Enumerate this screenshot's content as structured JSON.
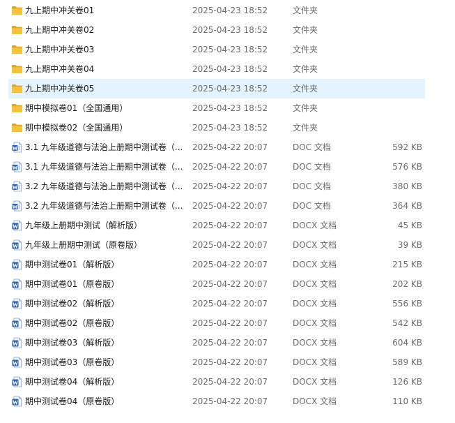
{
  "files": [
    {
      "name": "九上期中冲关卷01",
      "date": "2025-04-23 18:52",
      "type": "文件夹",
      "size": "",
      "icon": "folder-icon"
    },
    {
      "name": "九上期中冲关卷02",
      "date": "2025-04-23 18:52",
      "type": "文件夹",
      "size": "",
      "icon": "folder-icon"
    },
    {
      "name": "九上期中冲关卷03",
      "date": "2025-04-23 18:52",
      "type": "文件夹",
      "size": "",
      "icon": "folder-icon"
    },
    {
      "name": "九上期中冲关卷04",
      "date": "2025-04-23 18:52",
      "type": "文件夹",
      "size": "",
      "icon": "folder-icon"
    },
    {
      "name": "九上期中冲关卷05",
      "date": "2025-04-23 18:52",
      "type": "文件夹",
      "size": "",
      "icon": "folder-icon",
      "selected": true
    },
    {
      "name": "期中模拟卷01（全国通用）",
      "date": "2025-04-23 18:52",
      "type": "文件夹",
      "size": "",
      "icon": "folder-icon"
    },
    {
      "name": "期中模拟卷02（全国通用）",
      "date": "2025-04-23 18:52",
      "type": "文件夹",
      "size": "",
      "icon": "folder-icon"
    },
    {
      "name": "3.1 九年级道德与法治上册期中测试卷（...",
      "date": "2025-04-22 20:07",
      "type": "DOC 文档",
      "size": "592 KB",
      "icon": "word-doc-icon"
    },
    {
      "name": "3.1 九年级道德与法治上册期中测试卷（...",
      "date": "2025-04-22 20:07",
      "type": "DOC 文档",
      "size": "576 KB",
      "icon": "word-doc-icon"
    },
    {
      "name": "3.2 九年级道德与法治上册期中测试卷（...",
      "date": "2025-04-22 20:07",
      "type": "DOC 文档",
      "size": "380 KB",
      "icon": "word-doc-icon"
    },
    {
      "name": "3.2 九年级道德与法治上册期中测试卷（...",
      "date": "2025-04-22 20:07",
      "type": "DOC 文档",
      "size": "364 KB",
      "icon": "word-doc-icon"
    },
    {
      "name": "九年级上册期中测试（解析版）",
      "date": "2025-04-22 20:07",
      "type": "DOCX 文档",
      "size": "45 KB",
      "icon": "word-docx-icon"
    },
    {
      "name": "九年级上册期中测试（原卷版）",
      "date": "2025-04-22 20:07",
      "type": "DOCX 文档",
      "size": "39 KB",
      "icon": "word-docx-icon"
    },
    {
      "name": "期中测试卷01（解析版）",
      "date": "2025-04-22 20:07",
      "type": "DOCX 文档",
      "size": "215 KB",
      "icon": "word-docx-icon"
    },
    {
      "name": "期中测试卷01（原卷版）",
      "date": "2025-04-22 20:07",
      "type": "DOCX 文档",
      "size": "202 KB",
      "icon": "word-docx-icon"
    },
    {
      "name": "期中测试卷02（解析版）",
      "date": "2025-04-22 20:07",
      "type": "DOCX 文档",
      "size": "556 KB",
      "icon": "word-docx-icon"
    },
    {
      "name": "期中测试卷02（原卷版）",
      "date": "2025-04-22 20:07",
      "type": "DOCX 文档",
      "size": "542 KB",
      "icon": "word-docx-icon"
    },
    {
      "name": "期中测试卷03（解析版）",
      "date": "2025-04-22 20:07",
      "type": "DOCX 文档",
      "size": "604 KB",
      "icon": "word-docx-icon"
    },
    {
      "name": "期中测试卷03（原卷版）",
      "date": "2025-04-22 20:07",
      "type": "DOCX 文档",
      "size": "589 KB",
      "icon": "word-docx-icon"
    },
    {
      "name": "期中测试卷04（解析版）",
      "date": "2025-04-22 20:07",
      "type": "DOCX 文档",
      "size": "126 KB",
      "icon": "word-docx-icon"
    },
    {
      "name": "期中测试卷04（原卷版）",
      "date": "2025-04-22 20:07",
      "type": "DOCX 文档",
      "size": "110 KB",
      "icon": "word-docx-icon"
    }
  ],
  "colors": {
    "selected_row_bg": "#e5f3ff",
    "folder_yellow": "#f5c33b",
    "folder_dark": "#e0a91c",
    "word_blue": "#2b5fb3",
    "doc_bg": "#f3f6fb"
  }
}
